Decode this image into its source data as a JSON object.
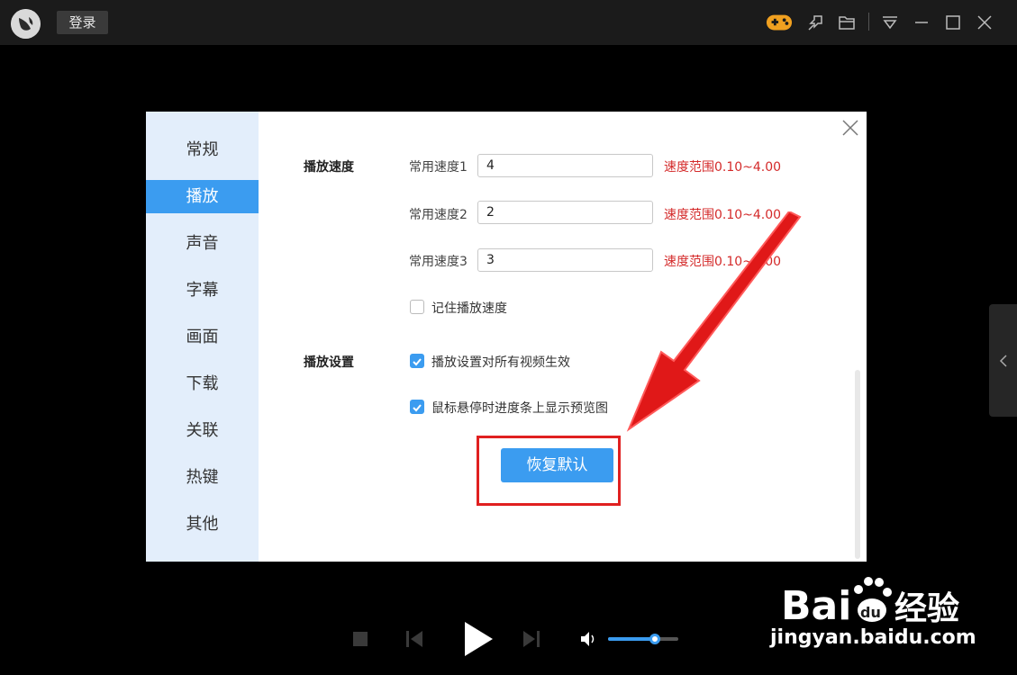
{
  "titlebar": {
    "login_label": "登录",
    "icons": [
      "app-logo-icon",
      "gamepad-icon",
      "pin-icon",
      "folder-icon",
      "menu-dropdown-icon",
      "minimize-icon",
      "maximize-icon",
      "close-icon"
    ]
  },
  "dialog": {
    "nav": [
      "常规",
      "播放",
      "声音",
      "字幕",
      "画面",
      "下载",
      "关联",
      "热键",
      "其他"
    ],
    "active_nav": "播放",
    "speed_section_label": "播放速度",
    "speeds": [
      {
        "label": "常用速度1",
        "value": "4",
        "hint": "速度范围0.10~4.00"
      },
      {
        "label": "常用速度2",
        "value": "2",
        "hint": "速度范围0.10~4.00"
      },
      {
        "label": "常用速度3",
        "value": "3",
        "hint": "速度范围0.10~4.00"
      }
    ],
    "remember_speed": {
      "label": "记住播放速度",
      "checked": false
    },
    "play_section_label": "播放设置",
    "play_options": [
      {
        "label": "播放设置对所有视频生效",
        "checked": true
      },
      {
        "label": "鼠标悬停时进度条上显示预览图",
        "checked": true
      }
    ],
    "restore_label": "恢复默认"
  },
  "player": {
    "volume_fraction": 0.67
  },
  "watermark": {
    "brand": "Bai du 经验",
    "url": "jingyan.baidu.com"
  },
  "colors": {
    "accent": "#3b9cf0",
    "warning": "#d42a2a",
    "annotation": "#e02020"
  }
}
